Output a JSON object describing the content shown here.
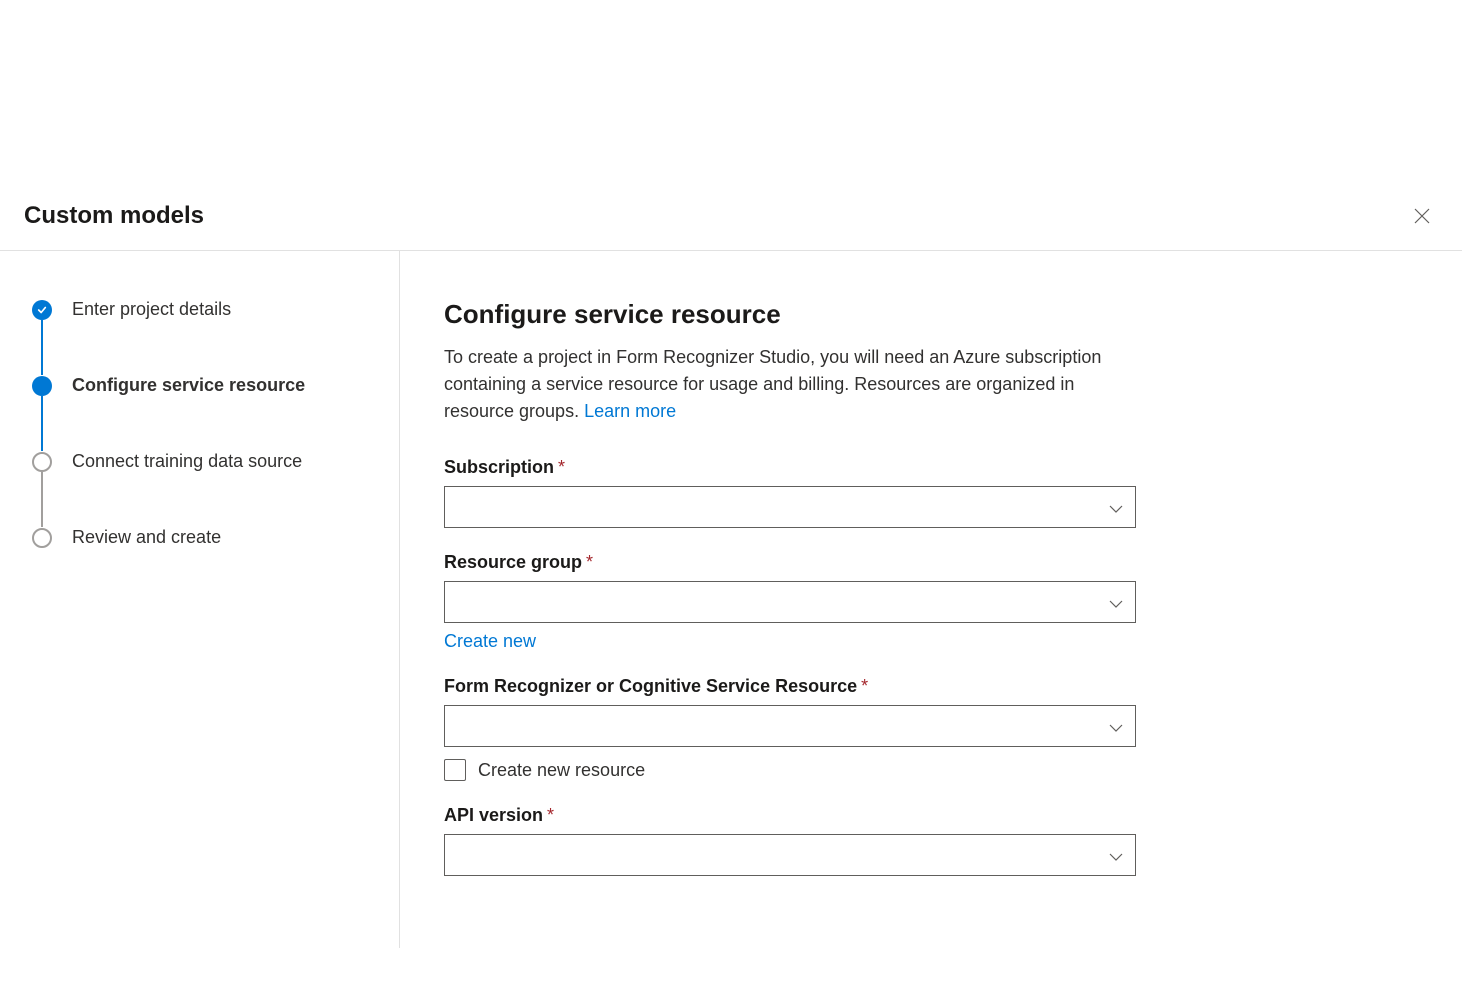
{
  "header": {
    "title": "Custom models"
  },
  "sidebar": {
    "steps": [
      {
        "label": "Enter project details",
        "state": "completed"
      },
      {
        "label": "Configure service resource",
        "state": "current"
      },
      {
        "label": "Connect training data source",
        "state": "upcoming"
      },
      {
        "label": "Review and create",
        "state": "upcoming"
      }
    ]
  },
  "main": {
    "title": "Configure service resource",
    "description": "To create a project in Form Recognizer Studio, you will need an Azure subscription containing a service resource for usage and billing. Resources are organized in resource groups. ",
    "learn_more": "Learn more",
    "fields": {
      "subscription": {
        "label": "Subscription",
        "value": ""
      },
      "resource_group": {
        "label": "Resource group",
        "value": "",
        "create_new": "Create new"
      },
      "service_resource": {
        "label": "Form Recognizer or Cognitive Service Resource",
        "value": "",
        "checkbox_label": "Create new resource"
      },
      "api_version": {
        "label": "API version",
        "value": ""
      }
    }
  }
}
